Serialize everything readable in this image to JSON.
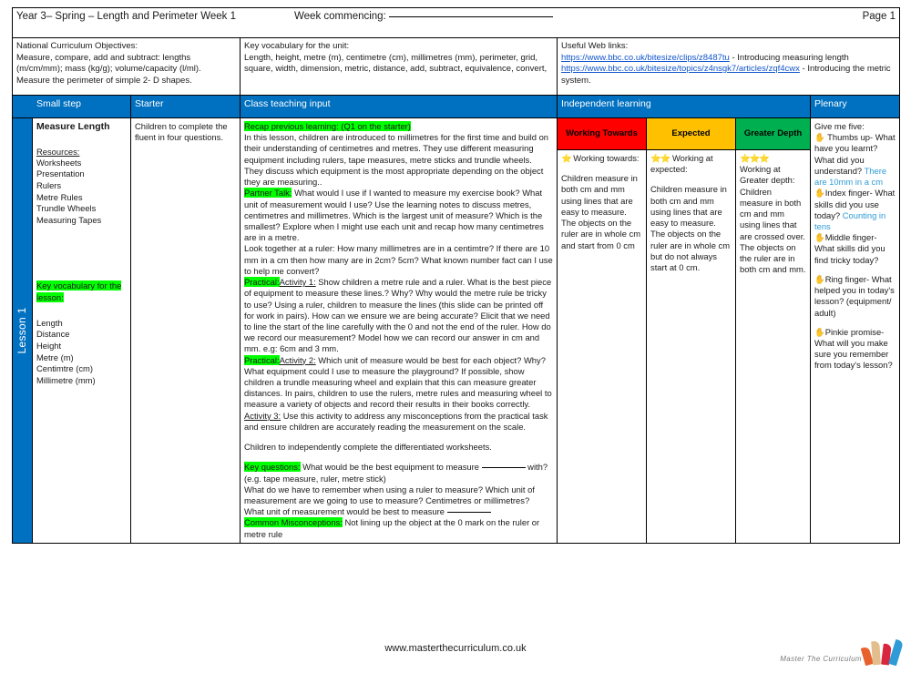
{
  "header": {
    "title": "Year 3– Spring – Length and Perimeter Week 1",
    "week_commencing_label": "Week commencing:",
    "page_label": "Page 1"
  },
  "info": {
    "objectives_label": "National Curriculum Objectives:",
    "objectives_text": "Measure, compare, add and subtract: lengths (m/cm/mm); mass (kg/g); volume/capacity (l/ml). Measure the perimeter of simple 2- D shapes.",
    "vocabulary_label": "Key vocabulary for the unit:",
    "vocabulary_text": "Length, height, metre (m), centimetre (cm), millimetres (mm), perimeter, grid, square, width, dimension, metric, distance, add, subtract, equivalence, convert,",
    "weblinks_label": "Useful Web links:",
    "weblinks": [
      {
        "url": "https://www.bbc.co.uk/bitesize/clips/z8487tu",
        "desc": " - Introducing measuring length"
      },
      {
        "url": "https://www.bbc.co.uk/bitesize/topics/z4nsgk7/articles/zqf4cwx",
        "desc": " - Introducing the metric system."
      }
    ]
  },
  "columns": {
    "small_step": "Small step",
    "starter": "Starter",
    "class_teaching": "Class teaching input",
    "independent": "Independent learning",
    "plenary": "Plenary"
  },
  "bands": {
    "working_towards": "Working Towards",
    "expected": "Expected",
    "greater_depth": "Greater Depth",
    "colors": {
      "working_towards": "#FF0000",
      "expected": "#FFC000",
      "greater_depth": "#00B050",
      "header_blue": "#0070C0",
      "highlight_green": "#00FF00",
      "answer_blue": "#2E9BD6"
    }
  },
  "lesson_spine": "Lesson 1",
  "small_step": {
    "title": "Measure Length",
    "resources_label": "Resources:",
    "resources": [
      "Worksheets",
      "Presentation",
      "Rulers",
      "Metre Rules",
      "Trundle Wheels",
      "Measuring Tapes"
    ],
    "key_vocab_label": "Key vocabulary for the lesson:",
    "key_vocab": [
      "Length",
      "Distance",
      "Height",
      "Metre (m)",
      "Centimtre (cm)",
      "Millimetre (mm)"
    ]
  },
  "starter": {
    "text": "Children to complete the fluent in four questions."
  },
  "teaching": {
    "recap_tag": "Recap previous learning: (Q1 on the starter)",
    "recap_text": "In this lesson, children are introduced to millimetres for the first time and build on their understanding of centimetres and metres. They use different measuring equipment including rulers, tape measures, metre sticks and trundle wheels. They discuss which equipment is the most appropriate depending on the object they are measuring..",
    "partner_talk_tag": "Partner Talk:",
    "partner_talk_text": " What would I use if I wanted to measure my exercise book?  What unit of measurement  would I use?  Use the learning notes to discuss metres, centimetres and millimetres. Which is the largest unit of measure?  Which is the smallest? Explore when I might use each unit and recap how many centimetres are in a metre.",
    "ruler_text": "Look together at a ruler: How many millimetres are in a centimtre?  If there are 10 mm in a cm then how many are in 2cm?  5cm?  What known number fact can I use to help me convert?",
    "practical_tag": "Practical:",
    "activity1_tag": "Activity 1:",
    "activity1_text": "  Show children a metre rule and a ruler. What is the best piece of equipment to measure these lines.?  Why?  Why would the metre rule be tricky to use? Using a ruler, children to measure the lines (this slide can be printed off for work in pairs).  How can we ensure we are being accurate?   Elicit that we need to line the start of the line carefully with the 0 and not the end of the ruler.  How do we record our measurement?  Model how we can record our answer in cm and mm. e.g: 6cm and 3 mm.",
    "activity2_tag": "Activity 2:",
    "activity2_text": "  Which unit of measure would be best for each object?  Why? What equipment could I use to measure the playground? If possible, show children a trundle measuring wheel and explain that this can measure greater distances.  In pairs, children to use the rulers, metre rules and measuring wheel to measure a variety of objects and record their results in their books correctly.",
    "activity3_tag": "Activity 3:",
    "activity3_text": "  Use this activity to address any misconceptions from the practical task and ensure children are accurately reading the measurement on the scale.",
    "independent_note": "Children to independently complete the differentiated worksheets.",
    "key_questions_tag": "Key questions:",
    "key_questions_line1_a": " What would be the best equipment to measure ",
    "key_questions_line1_b": " with? (e.g. tape measure, ruler, metre stick)",
    "key_questions_line2": "What do we have to remember when using a ruler to measure? Which unit of measurement are we going to use to measure? Centimetres or millimetres?",
    "key_questions_line3": "What unit of measurement would be best to measure ",
    "misconceptions_tag": "Common Misconceptions:",
    "misconceptions_text": " Not lining up the object at the 0 mark on the ruler or metre rule"
  },
  "independent": {
    "working_towards": {
      "stars": "⭐",
      "heading": " Working towards:",
      "text": "Children measure in both cm and mm using lines that are easy to measure. The objects on the ruler are in whole cm and start from 0 cm"
    },
    "expected": {
      "stars": "⭐⭐",
      "heading": " Working at expected:",
      "text": "Children measure in both cm and mm using lines that are easy to measure. The objects on the ruler are in whole cm but do not always start at 0 cm."
    },
    "greater_depth": {
      "stars": "⭐⭐⭐",
      "heading": "Working at Greater depth:",
      "text": "Children measure in both cm and mm using lines that are crossed over. The objects on the ruler are in both cm and mm."
    }
  },
  "plenary": {
    "intro": "Give me five:",
    "items": [
      {
        "icon": "hand-icon",
        "glyph": "✋",
        "prompt": "Thumbs up- What have you learnt? What did you understand?",
        "answer": "There are 10mm in a cm"
      },
      {
        "icon": "hand-icon",
        "glyph": "✋",
        "prompt": "Index finger- What skills did you use today?",
        "answer": "Counting in tens"
      },
      {
        "icon": "hand-icon",
        "glyph": "✋",
        "prompt": "Middle finger- What skills did you find tricky today?",
        "answer": ""
      },
      {
        "icon": "hand-icon",
        "glyph": "✋",
        "prompt": "Ring finger- What helped you in today's lesson? (equipment/ adult)",
        "answer": ""
      },
      {
        "icon": "hand-icon",
        "glyph": "✋",
        "prompt": "Pinkie promise- What will you make sure you remember from today's lesson?",
        "answer": ""
      }
    ]
  },
  "footer": {
    "url": "www.masterthecurriculum.co.uk",
    "logo_text": "Master  The  Curriculum"
  }
}
